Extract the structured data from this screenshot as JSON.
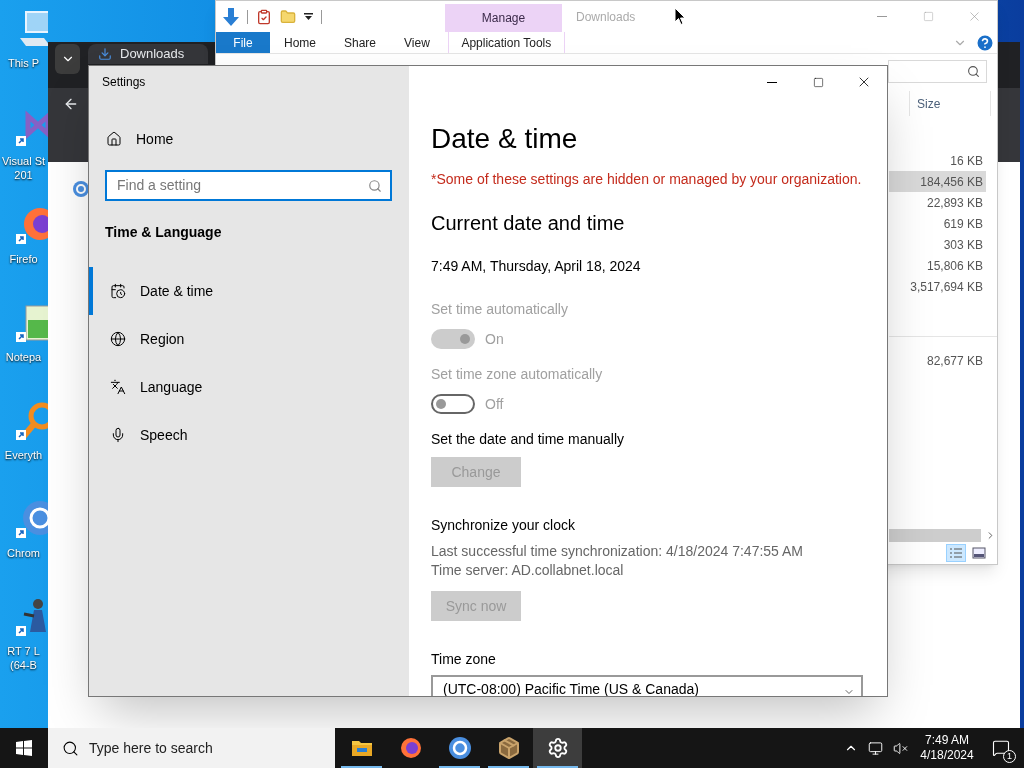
{
  "desktop_icons": [
    {
      "kind": "computer",
      "lines": [
        "This P"
      ]
    },
    {
      "kind": "infinity",
      "lines": [
        "Visual St",
        "201"
      ]
    },
    {
      "kind": "globe",
      "lines": [
        "Firefo"
      ]
    },
    {
      "kind": "notepad",
      "lines": [
        "Notepa"
      ]
    },
    {
      "kind": "magnifier",
      "lines": [
        "Everyth"
      ]
    },
    {
      "kind": "ring",
      "lines": [
        "Chrom"
      ]
    },
    {
      "kind": "figure",
      "lines": [
        "RT 7 L",
        "(64-B"
      ]
    }
  ],
  "browser": {
    "tab_title": "Downloads"
  },
  "explorer": {
    "title": "Downloads",
    "contextual_tab": "Manage",
    "ribbon_tabs": [
      {
        "kind": "file",
        "label": "File",
        "selected": false
      },
      {
        "kind": "tab",
        "label": "Home",
        "selected": false
      },
      {
        "kind": "tab",
        "label": "Share",
        "selected": false
      },
      {
        "kind": "tab",
        "label": "View",
        "selected": false
      },
      {
        "kind": "contextual",
        "label": "Application Tools",
        "selected": false
      }
    ],
    "column_header": "Size",
    "groups": [
      {
        "rows": [
          {
            "size": "16 KB",
            "selected": false
          },
          {
            "size": "184,456 KB",
            "selected": true
          },
          {
            "size": "22,893 KB",
            "selected": false
          },
          {
            "size": "619 KB",
            "selected": false
          },
          {
            "size": "303 KB",
            "selected": false
          },
          {
            "size": "15,806 KB",
            "selected": false
          },
          {
            "size": "3,517,694 KB",
            "selected": false
          }
        ]
      },
      {
        "rows": [
          {
            "size": "82,677 KB",
            "selected": false
          }
        ]
      }
    ],
    "view_buttons": [
      {
        "kind": "details",
        "selected": true
      },
      {
        "kind": "thumbnails",
        "selected": false
      }
    ]
  },
  "settings": {
    "title": "Settings",
    "home": "Home",
    "search": {
      "placeholder": "Find a setting"
    },
    "section": "Time & Language",
    "nav": [
      {
        "kind": "calendar",
        "label": "Date & time",
        "selected": true
      },
      {
        "kind": "globe",
        "label": "Region",
        "selected": false
      },
      {
        "kind": "language",
        "label": "Language",
        "selected": false
      },
      {
        "kind": "mic",
        "label": "Speech",
        "selected": false
      }
    ],
    "heading": "Date & time",
    "notice": "*Some of these settings are hidden or managed by your organization.",
    "subheading": "Current date and time",
    "current_time": "7:49 AM, Thursday, April 18, 2024",
    "items": [
      {
        "kind": "toggle",
        "label": "Set time automatically",
        "on": true,
        "disabled": true,
        "state_text": "On"
      },
      {
        "kind": "toggle",
        "label": "Set time zone automatically",
        "on": false,
        "disabled": true,
        "state_text": "Off"
      },
      {
        "kind": "button",
        "label": "Set the date and time manually",
        "button": "Change",
        "disabled": true
      },
      {
        "kind": "sync",
        "label": "Synchronize your clock",
        "lines": [
          "Last successful time synchronization: 4/18/2024 7:47:55 AM",
          "Time server: AD.collabnet.local"
        ],
        "button": "Sync now",
        "disabled": true
      },
      {
        "kind": "dropdown",
        "label": "Time zone",
        "value": "(UTC-08:00) Pacific Time (US & Canada)"
      }
    ]
  },
  "taskbar": {
    "search_placeholder": "Type here to search",
    "apps": [
      {
        "kind": "folder",
        "running": true,
        "selected": false
      },
      {
        "kind": "globe",
        "running": false,
        "selected": false
      },
      {
        "kind": "ring",
        "running": true,
        "selected": false
      },
      {
        "kind": "package",
        "running": true,
        "selected": false
      },
      {
        "kind": "gear",
        "running": true,
        "selected": true
      }
    ],
    "time": "7:49 AM",
    "date": "4/18/2024",
    "notification_count": "1"
  }
}
